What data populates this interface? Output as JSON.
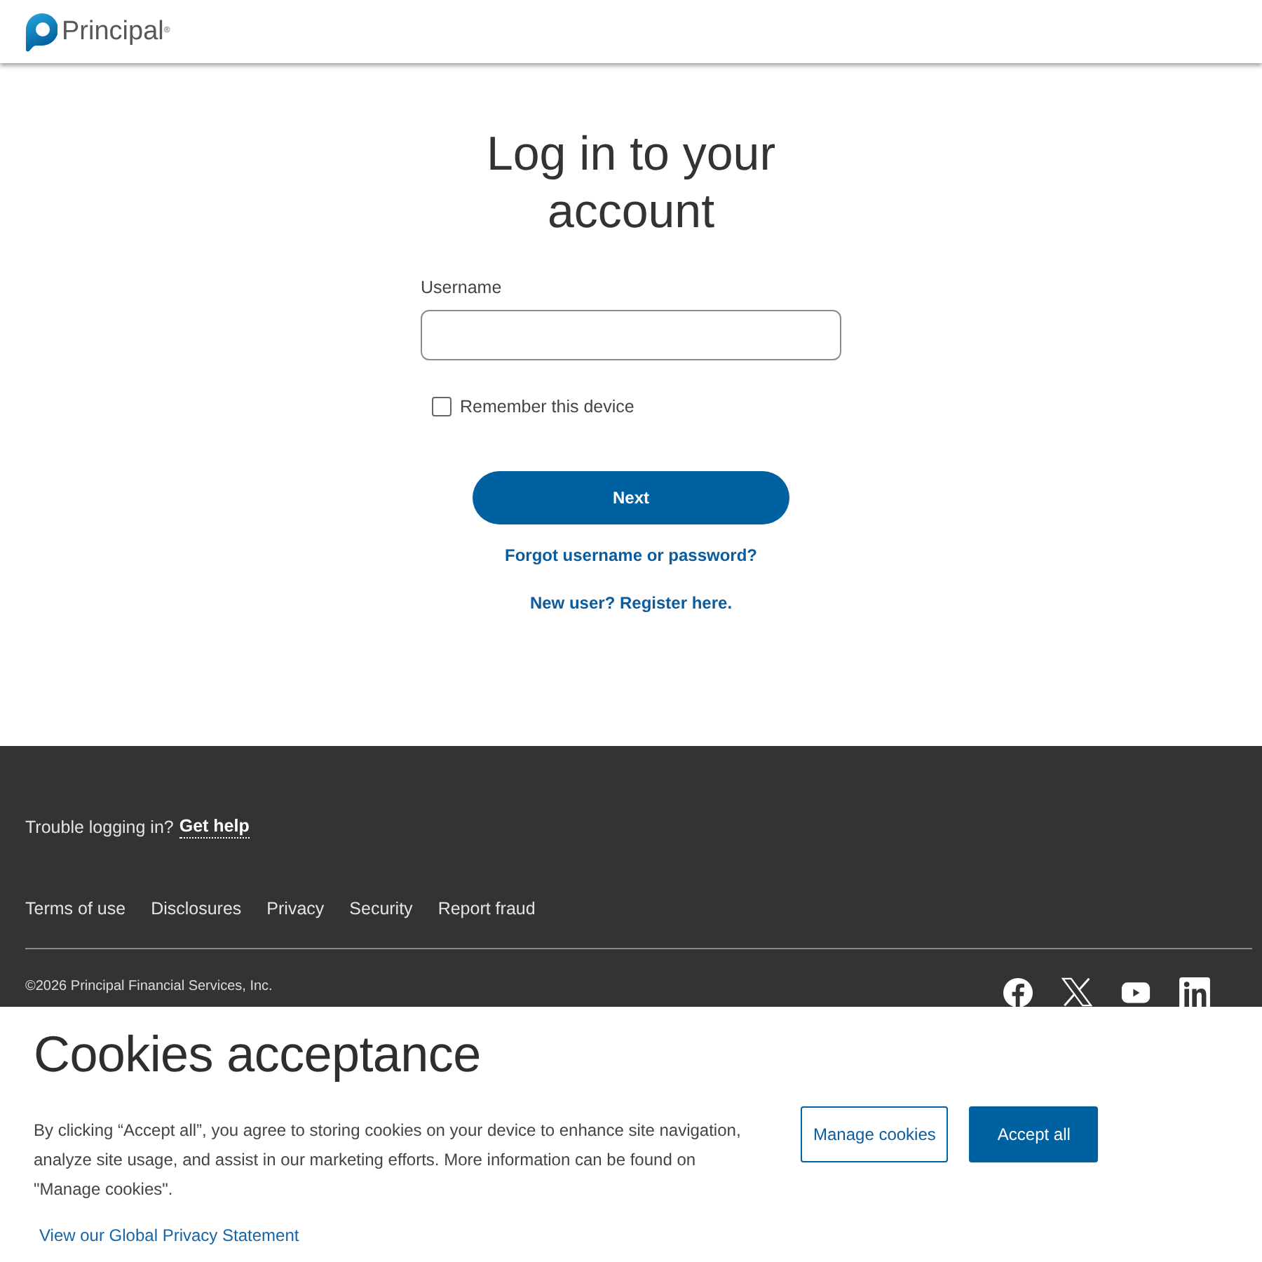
{
  "header": {
    "logo_text": "Principal$^{®}$"
  },
  "login": {
    "title": "Log in to your account",
    "username": {
      "label": "Username"
    },
    "remember": {
      "label": "Remember this device",
      "checked": false
    },
    "next_button": "Next",
    "links": [
      "Forgot username or password?",
      "New user? Register here."
    ]
  },
  "footer": {
    "help": {
      "text": "Trouble logging in?",
      "link": "Get help"
    },
    "links": [
      "Terms of use",
      "Disclosures",
      "Privacy",
      "Security",
      "Report fraud"
    ],
    "copyright": "©2026 Principal Financial Services, Inc."
  },
  "cookie_banner": {
    "title": "Cookies acceptance",
    "text": "By clicking “Accept all”, you agree to storing cookies on your device to enhance site navigation, analyze site usage, and assist in our marketing efforts. More information can be found on \"Manage cookies\".",
    "buttons": [
      {
        "label": "Manage cookies",
        "kind": "outline"
      },
      {
        "label": "Accept all",
        "kind": "primary"
      }
    ],
    "link": "View our Global Privacy Statement"
  }
}
